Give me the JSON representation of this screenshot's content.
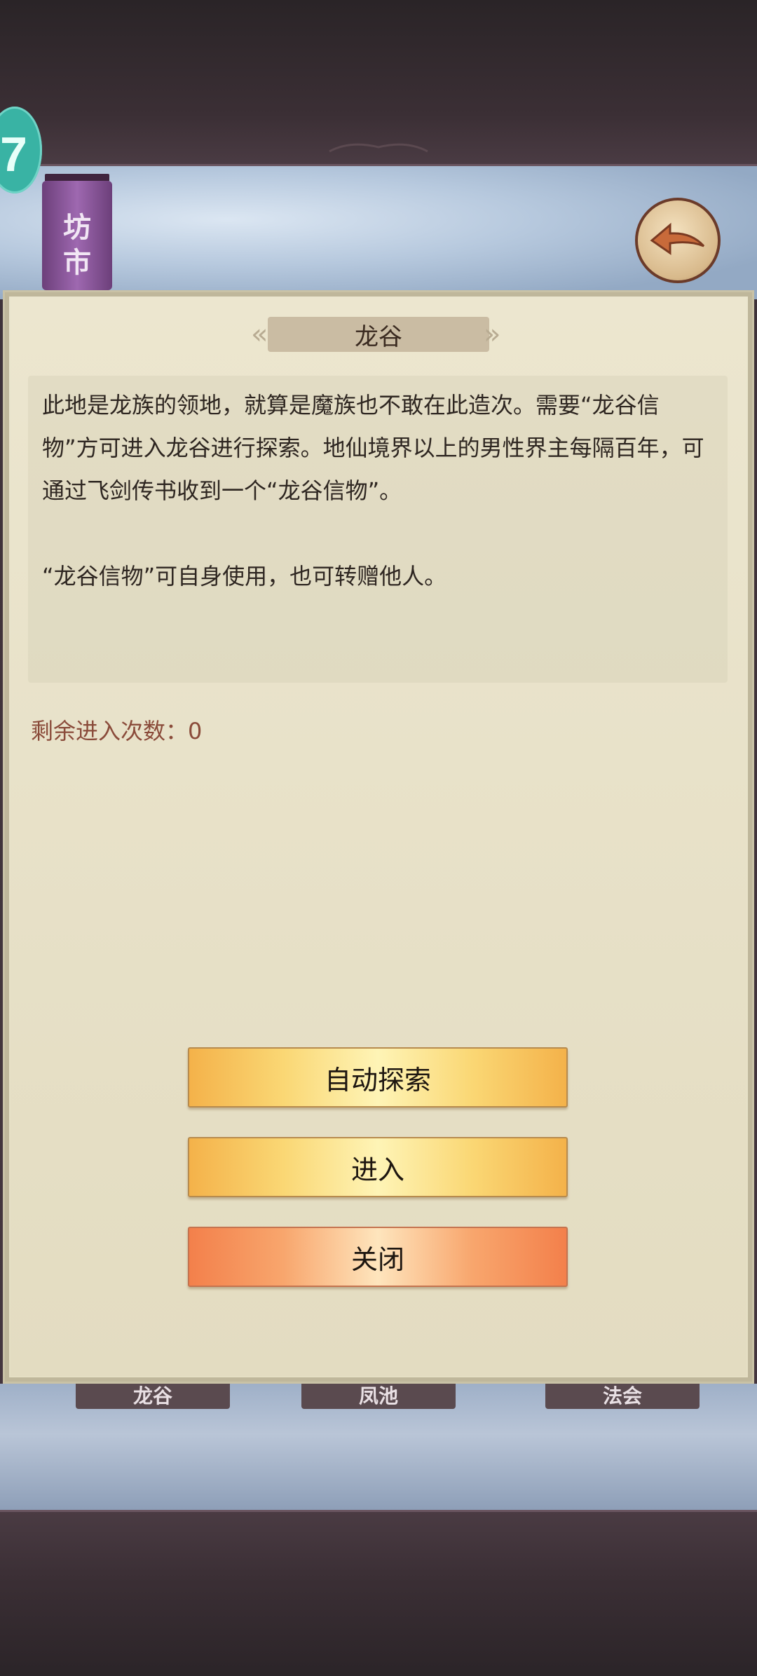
{
  "header": {
    "badge_number": "7",
    "location_banner": "坊\n市",
    "back_button_icon": "back-arrow-icon"
  },
  "dialog": {
    "title": "龙谷",
    "description": "此地是龙族的领地，就算是魔族也不敢在此造次。需要“龙谷信物”方可进入龙谷进行探索。地仙境界以上的男性界主每隔百年，可通过飞剑传书收到一个“龙谷信物”。\n\n“龙谷信物”可自身使用，也可转赠他人。",
    "remaining_label": "剩余进入次数：0",
    "buttons": {
      "auto_explore": "自动探索",
      "enter": "进入",
      "close": "关闭"
    }
  },
  "background_tabs": [
    "龙谷",
    "凤池",
    "法会"
  ],
  "colors": {
    "gold_button": "#fad774",
    "red_button": "#f8a66d",
    "panel_bg": "#ebe6cf",
    "remaining_text": "#8a4b3a"
  }
}
